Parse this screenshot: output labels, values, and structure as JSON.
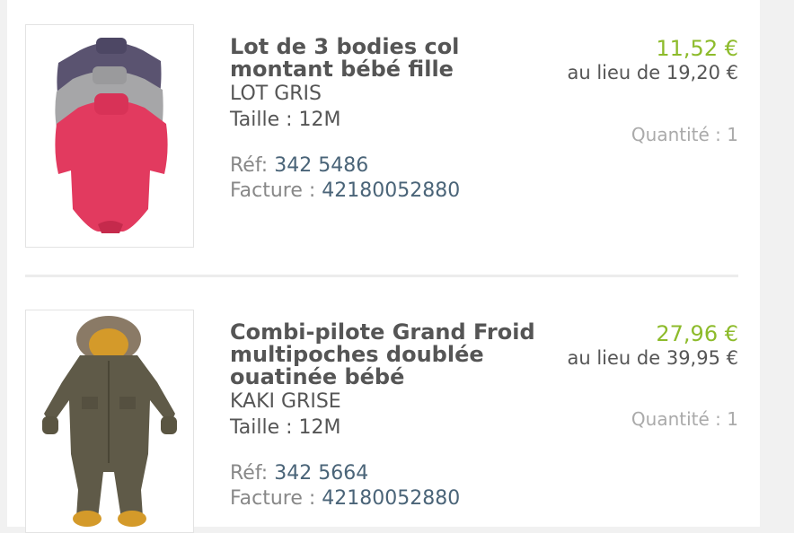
{
  "products": [
    {
      "title_line1": "Lot de 3 bodies col",
      "title_line2": "montant bébé fille",
      "title_line3": "",
      "variant": "LOT GRIS",
      "size": "Taille : 12M",
      "ref_label": "Réf:",
      "ref_value": "342 5486",
      "invoice_label": "Facture :",
      "invoice_value": "42180052880",
      "price": "11,52 €",
      "old_price": "au lieu de 19,20 €",
      "quantity": "Quantité : 1",
      "image_icon": "baby-bodysuits-image"
    },
    {
      "title_line1": "Combi-pilote Grand Froid",
      "title_line2": "multipoches doublée",
      "title_line3": "ouatinée bébé",
      "variant": "KAKI GRISE",
      "size": "Taille : 12M",
      "ref_label": "Réf:",
      "ref_value": "342 5664",
      "invoice_label": "Facture :",
      "invoice_value": "42180052880",
      "price": "27,96 €",
      "old_price": "au lieu de 39,95 €",
      "quantity": "Quantité : 1",
      "image_icon": "snowsuit-image"
    }
  ],
  "colors": {
    "price_green": "#8dbb2b",
    "text_gray": "#555555",
    "ref_blue": "#4a6478",
    "light_gray": "#aaaaaa"
  }
}
